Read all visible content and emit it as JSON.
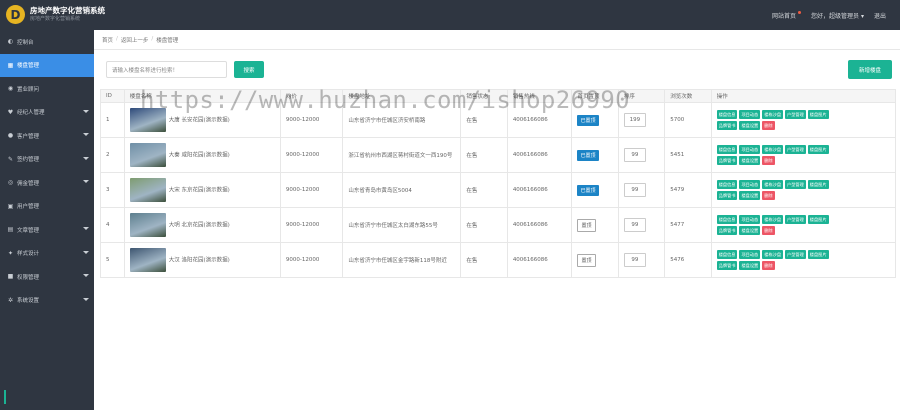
{
  "header": {
    "title": "房地产数字化营销系统",
    "subtitle": "房地产数字化营销系统",
    "logo_letter": "D",
    "nav": {
      "home": "网站首页",
      "greeting": "您好，超级管理员",
      "logout": "退出"
    }
  },
  "sidebar": {
    "items": [
      {
        "label": "控制台",
        "icon": "dashboard-icon",
        "glyph": "◐",
        "expandable": false,
        "active": false
      },
      {
        "label": "楼盘管理",
        "icon": "building-icon",
        "glyph": "▦",
        "expandable": false,
        "active": true
      },
      {
        "label": "置业顾问",
        "icon": "advisor-icon",
        "glyph": "◉",
        "expandable": false,
        "active": false
      },
      {
        "label": "经纪人管理",
        "icon": "broker-icon",
        "glyph": "♥",
        "expandable": true,
        "active": false
      },
      {
        "label": "客户管理",
        "icon": "user-icon",
        "glyph": "●",
        "expandable": true,
        "active": false
      },
      {
        "label": "签约管理",
        "icon": "pen-icon",
        "glyph": "✎",
        "expandable": true,
        "active": false
      },
      {
        "label": "佣金管理",
        "icon": "coin-icon",
        "glyph": "◎",
        "expandable": true,
        "active": false
      },
      {
        "label": "用户管理",
        "icon": "users-icon",
        "glyph": "▣",
        "expandable": false,
        "active": false
      },
      {
        "label": "文章管理",
        "icon": "article-icon",
        "glyph": "▤",
        "expandable": true,
        "active": false
      },
      {
        "label": "样式设计",
        "icon": "palette-icon",
        "glyph": "✦",
        "expandable": true,
        "active": false
      },
      {
        "label": "权限管理",
        "icon": "lock-icon",
        "glyph": "■",
        "expandable": true,
        "active": false
      },
      {
        "label": "系统设置",
        "icon": "gear-icon",
        "glyph": "✲",
        "expandable": true,
        "active": false
      }
    ]
  },
  "breadcrumb": {
    "home": "首页",
    "back": "返回上一步",
    "current": "楼盘管理",
    "separator": "/"
  },
  "search": {
    "placeholder": "请输入楼盘名称进行检索！",
    "button": "搜索"
  },
  "add_button": "新增楼盘",
  "watermark": "https://www.huzhan.com/ishop26990",
  "table": {
    "columns": [
      "ID",
      "楼盘名称",
      "均价",
      "楼盘地址",
      "销售状态",
      "销售热线",
      "首页置顶",
      "排序",
      "浏览次数",
      "操作"
    ],
    "rows": [
      {
        "id": "1",
        "name": "大唐 长安花园(演示数据)",
        "price": "9000-12000",
        "address": "山东省济宁市任城区济安桥南路",
        "status": "在售",
        "hotline": "4006166086",
        "top": "已置顶",
        "top_active": true,
        "sort": "199",
        "views": "5700",
        "thumb": "#2e4a7a"
      },
      {
        "id": "2",
        "name": "大秦 咸阳花园(演示数据)",
        "price": "9000-12000",
        "address": "浙江省杭州市西湖区蒋村街道文一西190号",
        "status": "在售",
        "hotline": "4006166086",
        "top": "已置顶",
        "top_active": true,
        "sort": "99",
        "views": "5451",
        "thumb": "#6f8fa6"
      },
      {
        "id": "3",
        "name": "大宋 东京花园(演示数据)",
        "price": "9000-12000",
        "address": "山东省青岛市黄岛区5004",
        "status": "在售",
        "hotline": "4006166086",
        "top": "已置顶",
        "top_active": true,
        "sort": "99",
        "views": "5479",
        "thumb": "#7e9c70"
      },
      {
        "id": "4",
        "name": "大明 北京花园(演示数据)",
        "price": "9000-12000",
        "address": "山东省济宁市任城区太白湖东路55号",
        "status": "在售",
        "hotline": "4006166086",
        "top": "置顶",
        "top_active": false,
        "sort": "99",
        "views": "5477",
        "thumb": "#5d7f8e"
      },
      {
        "id": "5",
        "name": "大汉 洛阳花园(演示数据)",
        "price": "9000-12000",
        "address": "山东省济宁市任城区金宇路新118号附近",
        "status": "在售",
        "hotline": "4006166086",
        "top": "置顶",
        "top_active": false,
        "sort": "99",
        "views": "5476",
        "thumb": "#3d5570"
      }
    ],
    "operations": [
      "楼盘信息",
      "项目动态",
      "楼栋沙盘",
      "户型管理",
      "楼盘图片",
      "品牌管书",
      "楼盘设置",
      "删除"
    ]
  }
}
